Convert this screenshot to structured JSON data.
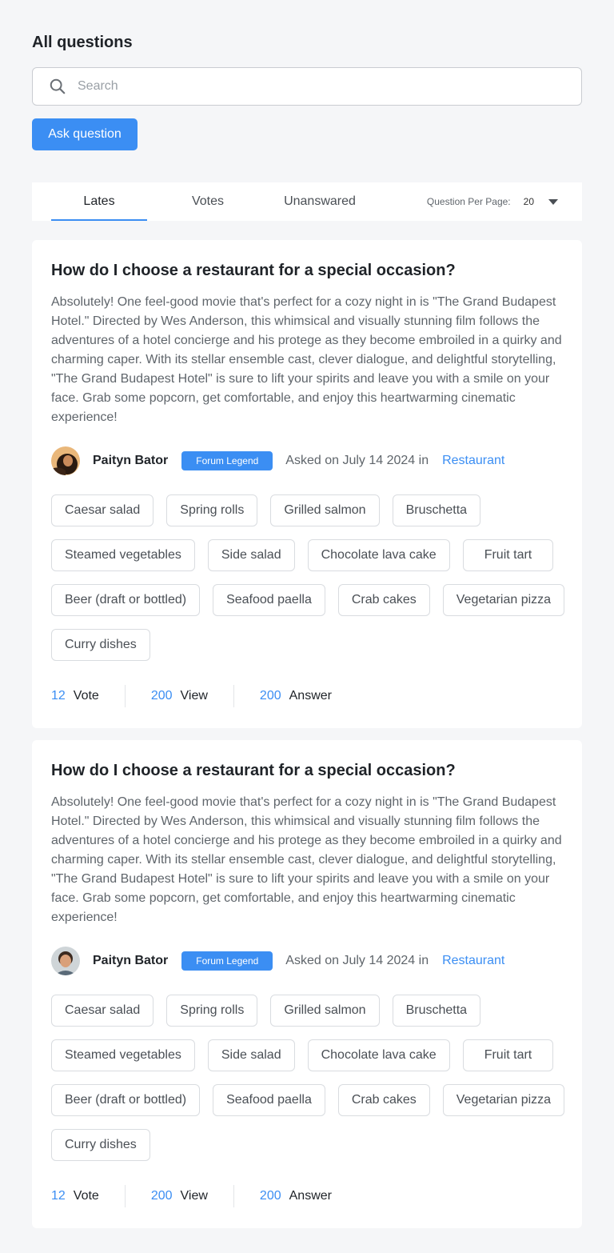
{
  "page_title": "All questions",
  "search": {
    "placeholder": "Search",
    "value": ""
  },
  "ask_button_label": "Ask question",
  "tabs": [
    {
      "label": "Lates",
      "active": true
    },
    {
      "label": "Votes",
      "active": false
    },
    {
      "label": "Unanswared",
      "active": false
    }
  ],
  "per_page": {
    "label": "Question Per Page:",
    "value": "20"
  },
  "colors": {
    "accent": "#3b8ef3",
    "background": "#f5f6f8"
  },
  "questions": [
    {
      "title": "How do I choose a restaurant for a special occasion?",
      "body": "Absolutely! One feel-good movie that's perfect for a cozy night in is \"The Grand Budapest Hotel.\" Directed by Wes Anderson, this whimsical and visually stunning film follows the adventures of a hotel concierge and his protege as they become embroiled in a quirky and charming caper. With its stellar ensemble cast, clever dialogue, and delightful storytelling, \"The Grand Budapest Hotel\" is sure to lift your spirits and leave you with a smile on your face. Grab some popcorn, get comfortable, and enjoy this heartwarming cinematic experience!",
      "author": "Paityn Bator",
      "badge": "Forum Legend",
      "asked": "Asked on July 14 2024 in",
      "category": "Restaurant",
      "tags": [
        "Caesar salad",
        "Spring rolls",
        "Grilled salmon",
        "Bruschetta",
        "Steamed vegetables",
        "Side salad",
        "Chocolate lava cake",
        "Fruit tart",
        "Beer (draft or bottled)",
        "Seafood paella",
        "Crab cakes",
        "Vegetarian pizza",
        "Curry dishes"
      ],
      "votes": "12",
      "votes_label": "Vote",
      "views": "200",
      "views_label": "View",
      "answers": "200",
      "answers_label": "Answer"
    },
    {
      "title": "How do I choose a restaurant for a special occasion?",
      "body": "Absolutely! One feel-good movie that's perfect for a cozy night in is \"The Grand Budapest Hotel.\" Directed by Wes Anderson, this whimsical and visually stunning film follows the adventures of a hotel concierge and his protege as they become embroiled in a quirky and charming caper. With its stellar ensemble cast, clever dialogue, and delightful storytelling, \"The Grand Budapest Hotel\" is sure to lift your spirits and leave you with a smile on your face. Grab some popcorn, get comfortable, and enjoy this heartwarming cinematic experience!",
      "author": "Paityn Bator",
      "badge": "Forum Legend",
      "asked": "Asked on July 14 2024 in",
      "category": "Restaurant",
      "tags": [
        "Caesar salad",
        "Spring rolls",
        "Grilled salmon",
        "Bruschetta",
        "Steamed vegetables",
        "Side salad",
        "Chocolate lava cake",
        "Fruit tart",
        "Beer (draft or bottled)",
        "Seafood paella",
        "Crab cakes",
        "Vegetarian pizza",
        "Curry dishes"
      ],
      "votes": "12",
      "votes_label": "Vote",
      "views": "200",
      "views_label": "View",
      "answers": "200",
      "answers_label": "Answer"
    }
  ]
}
